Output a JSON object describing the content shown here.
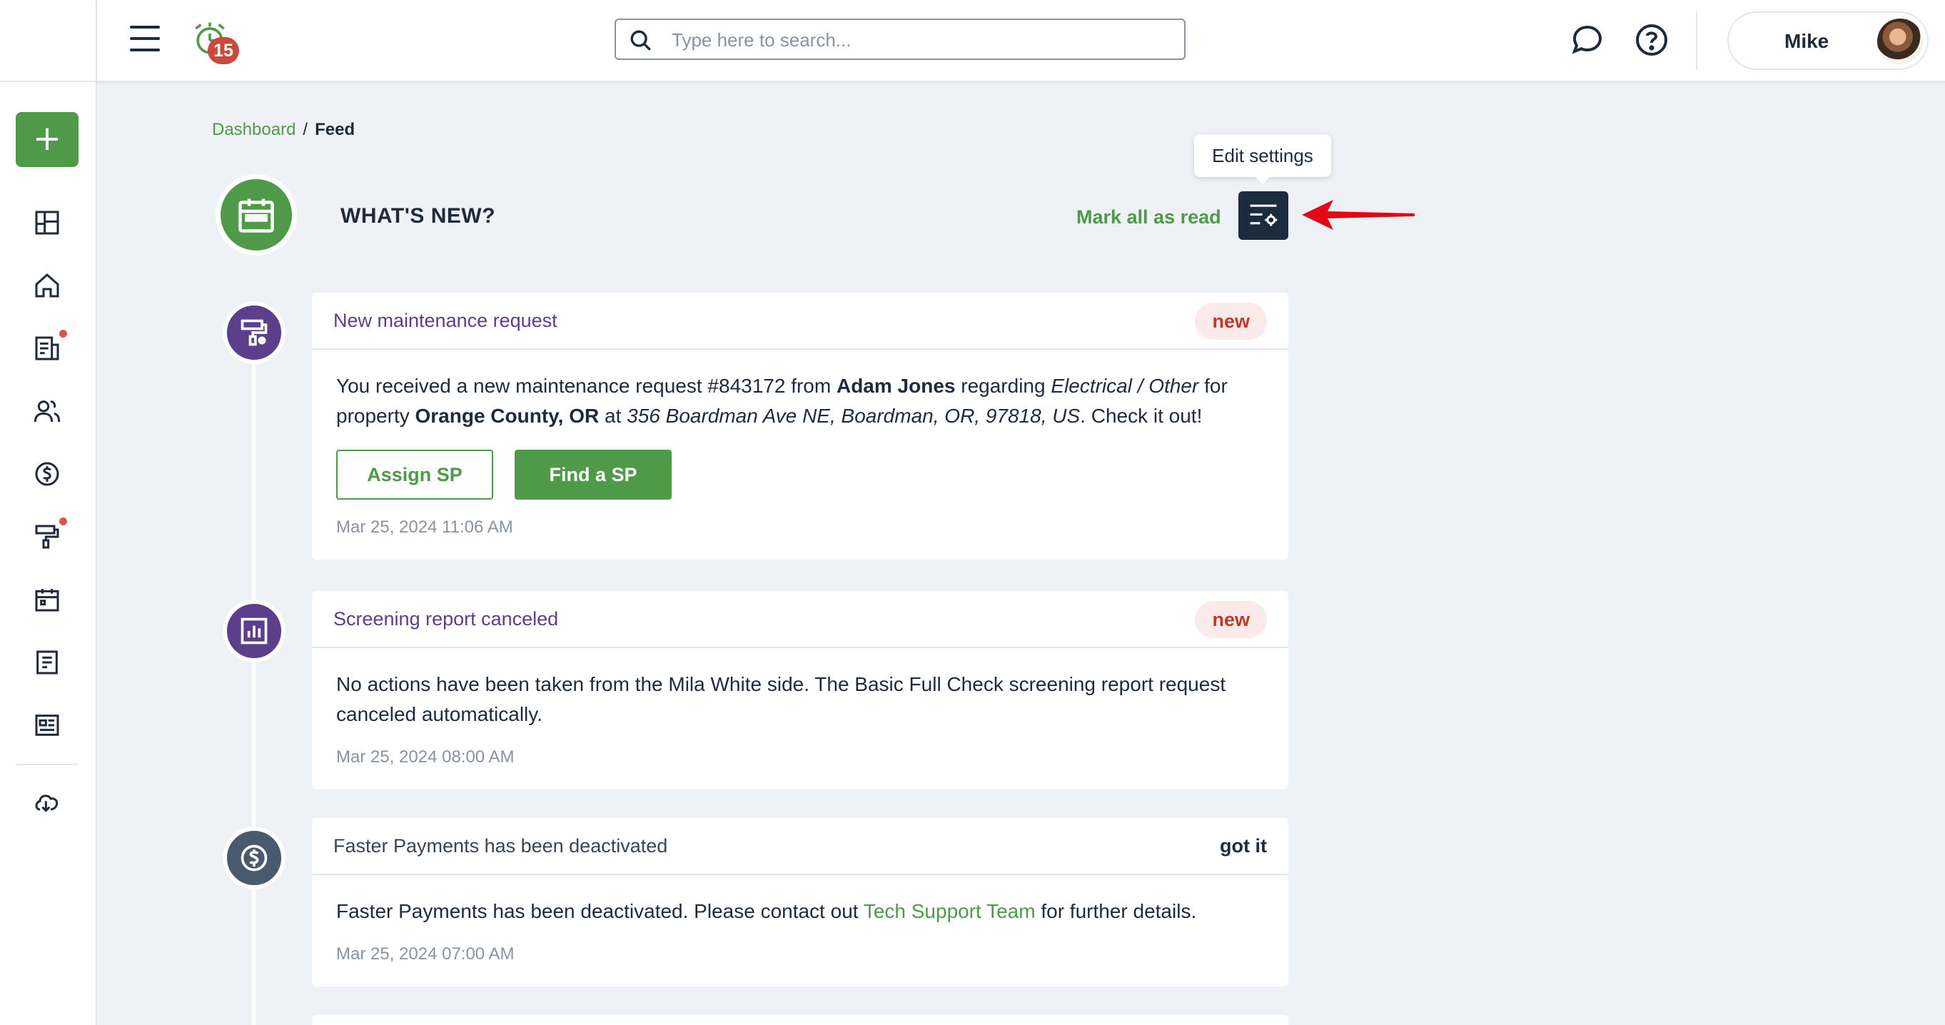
{
  "header": {
    "notification_count": "15",
    "search_placeholder": "Type here to search...",
    "user_name": "Mike"
  },
  "breadcrumb": {
    "link": "Dashboard",
    "separator": "/",
    "current": "Feed"
  },
  "feed": {
    "title": "WHAT'S NEW?",
    "mark_all_read": "Mark all as read",
    "tooltip": "Edit settings"
  },
  "cards": [
    {
      "title": "New maintenance request",
      "badge": "new",
      "body": {
        "t1": "You received a new maintenance request #843172 from ",
        "name": "Adam Jones",
        "t2": " regarding ",
        "category": "Electrical / Other",
        "t3": " for property ",
        "property": "Orange County, OR",
        "t4": " at ",
        "address": "356 Boardman Ave NE, Boardman, OR, 97818, US",
        "t5": ". Check it out!"
      },
      "buttons": {
        "assign": "Assign SP",
        "find": "Find a SP"
      },
      "timestamp": "Mar 25, 2024 11:06 AM"
    },
    {
      "title": "Screening report canceled",
      "badge": "new",
      "body": "No actions have been taken from the Mila White side. The Basic Full Check screening report request canceled automatically.",
      "timestamp": "Mar 25, 2024 08:00 AM"
    },
    {
      "title": "Faster Payments has been deactivated",
      "badge": "got it",
      "body": {
        "t1": "Faster Payments has been deactivated. Please contact out ",
        "link": "Tech Support Team",
        "t2": " for further details."
      },
      "timestamp": "Mar 25, 2024 07:00 AM"
    }
  ],
  "colors": {
    "accent_green": "#4f9a48",
    "dark_navy": "#1c2b3e",
    "purple": "#5c3f8c",
    "slate": "#4a5a6e",
    "badge_red": "#c0392b"
  },
  "icons": {
    "sidebar": [
      "dashboard-icon",
      "home-icon",
      "leases-icon",
      "people-icon",
      "accounting-icon",
      "maintenance-icon",
      "calendar-icon",
      "reports-icon",
      "listings-icon",
      "download-icon"
    ]
  }
}
